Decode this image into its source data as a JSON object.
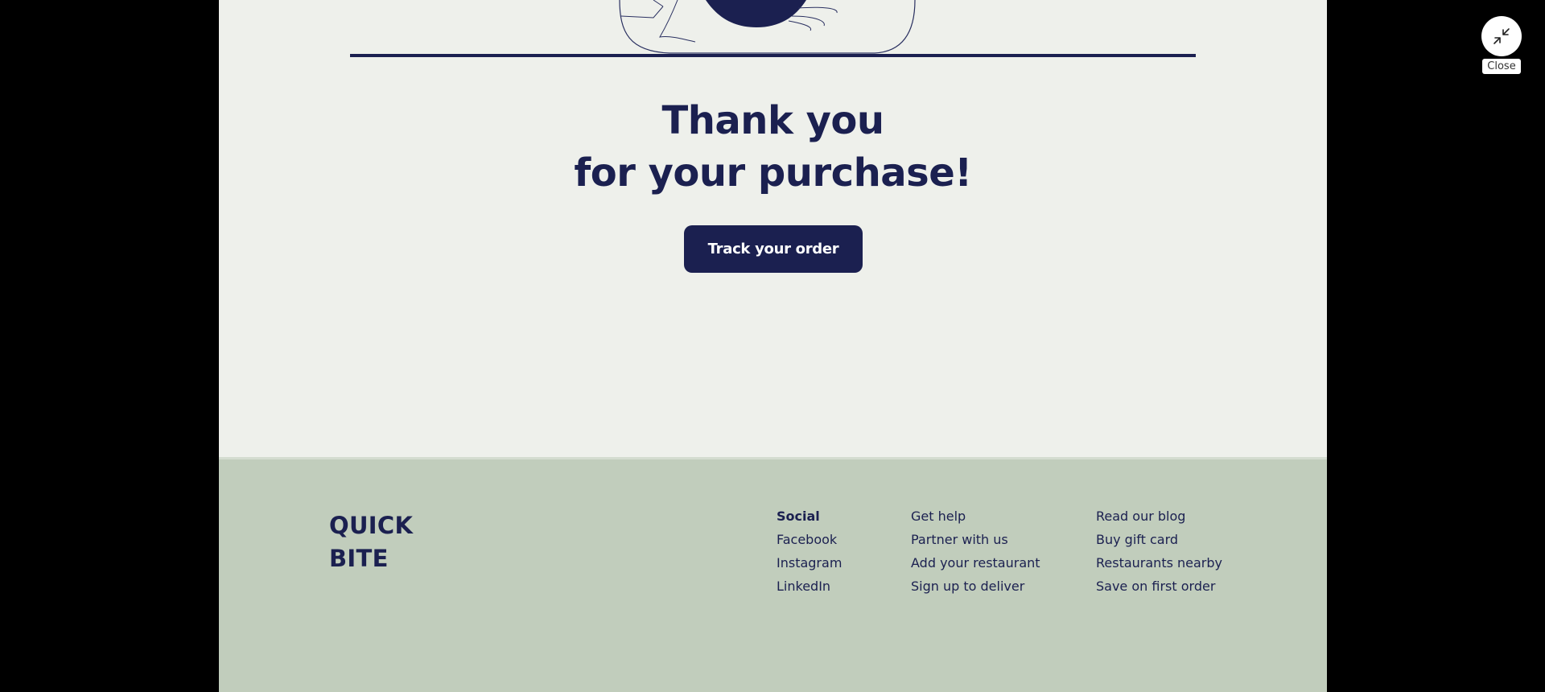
{
  "hero": {
    "line1": "Thank you",
    "line2": "for your purchase!",
    "button_label": "Track your order"
  },
  "footer": {
    "brand_line1": "QUICK",
    "brand_line2": "BITE",
    "columns": [
      {
        "items": [
          "Social",
          "Facebook",
          "Instagram",
          "LinkedIn"
        ]
      },
      {
        "items": [
          "Get help",
          "Partner with us",
          "Add your restaurant",
          "Sign up to deliver"
        ]
      },
      {
        "items": [
          "Read our blog",
          "Buy gift card",
          "Restaurants nearby",
          "Save on first order"
        ]
      }
    ]
  },
  "overlay": {
    "close_label": "Close",
    "close_icon": "minimize-arrows-icon"
  },
  "colors": {
    "page_bg": "#eef0eb",
    "footer_bg": "#c1cdbc",
    "navy": "#1b2050",
    "outer_bg": "#000000"
  }
}
